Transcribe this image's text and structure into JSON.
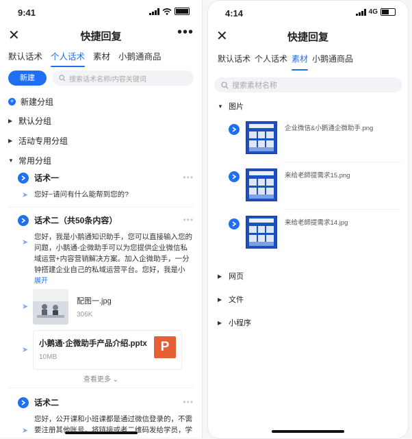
{
  "left": {
    "status": {
      "time": "9:41"
    },
    "header": {
      "close_icon": "close-icon",
      "title": "快捷回复",
      "more_label": "•••"
    },
    "tabs": [
      {
        "label": "默认话术",
        "active": false
      },
      {
        "label": "个人话术",
        "active": true
      },
      {
        "label": "素材",
        "active": false
      },
      {
        "label": "小鹅通商品",
        "active": false
      }
    ],
    "toolbar": {
      "new_label": "新建",
      "search_placeholder": "搜索话术名称/内容关键词"
    },
    "add_group_label": "新建分组",
    "groups": [
      {
        "label": "默认分组",
        "expanded": false
      },
      {
        "label": "活动专用分组",
        "expanded": false
      },
      {
        "label": "常用分组",
        "expanded": true
      }
    ],
    "items": [
      {
        "title": "话术一",
        "messages": [
          "您好~请问有什么能帮到您的?"
        ]
      },
      {
        "title": "话术二（共50条内容）",
        "text": "您好，我是小鹅通知识助手，您可以直接输入您的问题，小鹅通-企微助手可以为您提供企业微信私域运营+内容营销解决方案。加入企微助手，一分钟搭建企业自己的私域运营平台。您好，我是小鹅......",
        "expand_label": "展开",
        "image": {
          "name": "配图一.jpg",
          "size": "306K"
        },
        "file": {
          "name": "小鹅通·企微助手产品介绍.pptx",
          "size": "10MB",
          "icon_letter": "P"
        },
        "see_more_label": "查看更多"
      },
      {
        "title": "话术二",
        "text": "您好，公开课和小班课都是通过微信登录的，不需要注册其他账号。将链接或者二维码发给学员，学"
      }
    ]
  },
  "right": {
    "status": {
      "time": "4:14",
      "network": "4G"
    },
    "header": {
      "close_icon": "close-icon",
      "title": "快捷回复"
    },
    "tabs": [
      {
        "label": "默认话术",
        "active": false
      },
      {
        "label": "个人话术",
        "active": false
      },
      {
        "label": "素材",
        "active": true
      },
      {
        "label": "小鹅通商品",
        "active": false
      }
    ],
    "search_placeholder": "搜索素材名称",
    "image_group_label": "图片",
    "assets": [
      {
        "name": "企业微信&小鹅通企微助手.png"
      },
      {
        "name": "来给老師提需求15.png"
      },
      {
        "name": "来给老師提需求14.jpg"
      }
    ],
    "other_groups": [
      {
        "label": "网页"
      },
      {
        "label": "文件"
      },
      {
        "label": "小程序"
      }
    ]
  },
  "colors": {
    "accent": "#1f6ff2",
    "ppt": "#e75f34"
  }
}
